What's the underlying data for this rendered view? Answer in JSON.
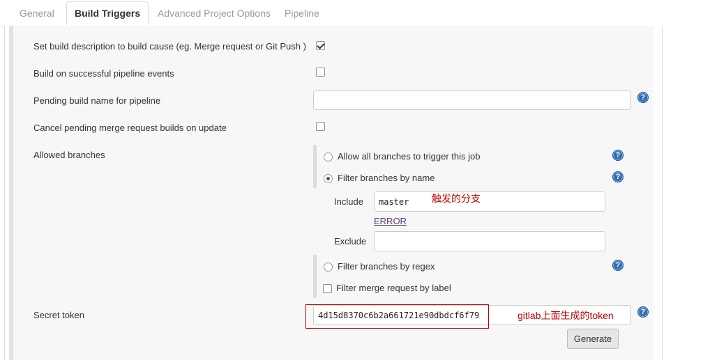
{
  "tabs": [
    {
      "label": "General",
      "active": false
    },
    {
      "label": "Build Triggers",
      "active": true
    },
    {
      "label": "Advanced Project Options",
      "active": false
    },
    {
      "label": "Pipeline",
      "active": false
    }
  ],
  "options": {
    "set_description": {
      "label": "Set build description to build cause (eg. Merge request or Git Push )",
      "checked": true
    },
    "pipeline_events": {
      "label": "Build on successful pipeline events",
      "checked": false
    },
    "pending_build_name": {
      "label": "Pending build name for pipeline",
      "value": ""
    },
    "cancel_pending": {
      "label": "Cancel pending merge request builds on update",
      "checked": false
    },
    "allowed_branches": {
      "label": "Allowed branches",
      "allow_all": "Allow all branches to trigger this job",
      "filter_by_name": "Filter branches by name",
      "include_label": "Include",
      "include_value": "master",
      "error": "ERROR",
      "exclude_label": "Exclude",
      "exclude_value": "",
      "filter_by_regex": "Filter branches by regex",
      "filter_by_label": "Filter merge request by label",
      "selected": "filter_by_name"
    },
    "secret_token": {
      "label": "Secret token",
      "value": "4d15d8370c6b2a661721e90dbdcf6f79",
      "generate": "Generate"
    }
  },
  "annotations": {
    "include_note": "触发的分支",
    "token_note": "gitlab上面生成的token"
  },
  "help_glyph": "?",
  "icons": {
    "help": "help-icon"
  },
  "colors": {
    "annotation": "#c00000",
    "help": "#2e6db4"
  }
}
